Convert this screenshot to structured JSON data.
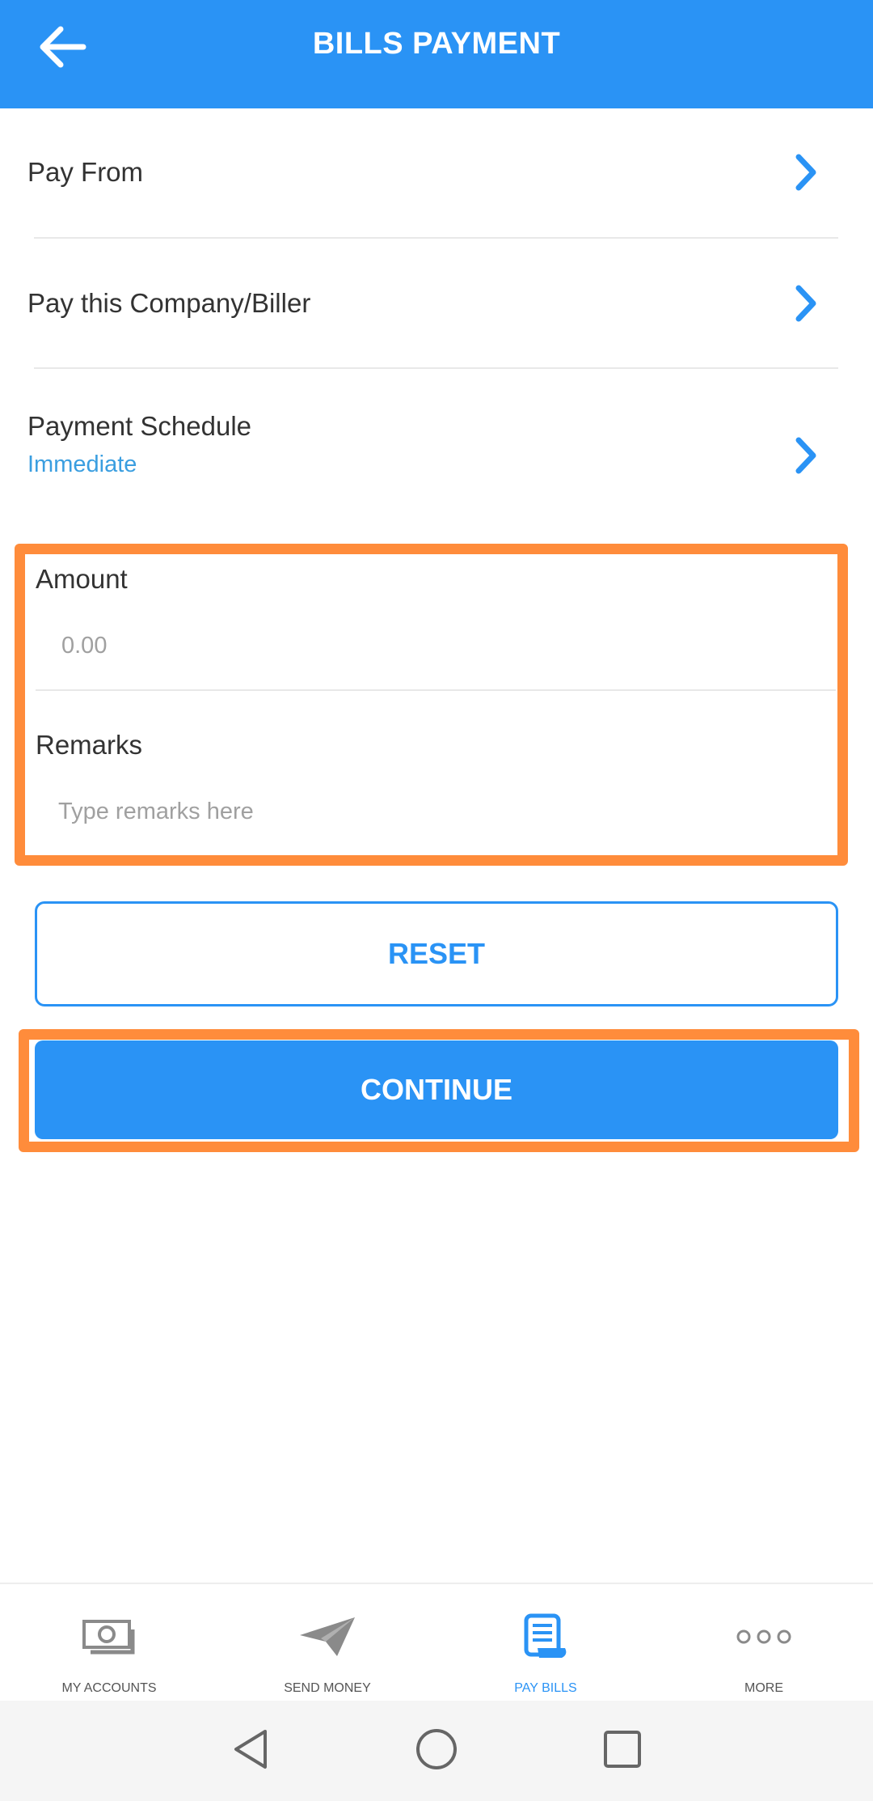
{
  "header": {
    "title": "BILLS PAYMENT",
    "back_icon": "arrow-left-icon",
    "color": "#2a93f5"
  },
  "rows": {
    "pay_from": {
      "label": "Pay From"
    },
    "biller": {
      "label": "Pay this Company/Biller"
    },
    "schedule": {
      "label": "Payment Schedule",
      "value": "Immediate"
    }
  },
  "form": {
    "amount_label": "Amount",
    "amount_placeholder": "0.00",
    "remarks_label": "Remarks",
    "remarks_placeholder": "Type remarks here"
  },
  "buttons": {
    "reset": "RESET",
    "continue": "CONTINUE"
  },
  "bottom_nav": {
    "items": [
      {
        "label": "MY ACCOUNTS",
        "icon": "cash-icon",
        "active": false
      },
      {
        "label": "SEND MONEY",
        "icon": "paper-plane-icon",
        "active": false
      },
      {
        "label": "PAY BILLS",
        "icon": "bill-receipt-icon",
        "active": true
      },
      {
        "label": "MORE",
        "icon": "more-dots-icon",
        "active": false
      }
    ]
  },
  "colors": {
    "accent": "#2a93f5",
    "highlight": "#ff8c3b",
    "schedule_value": "#3a9ee0"
  }
}
